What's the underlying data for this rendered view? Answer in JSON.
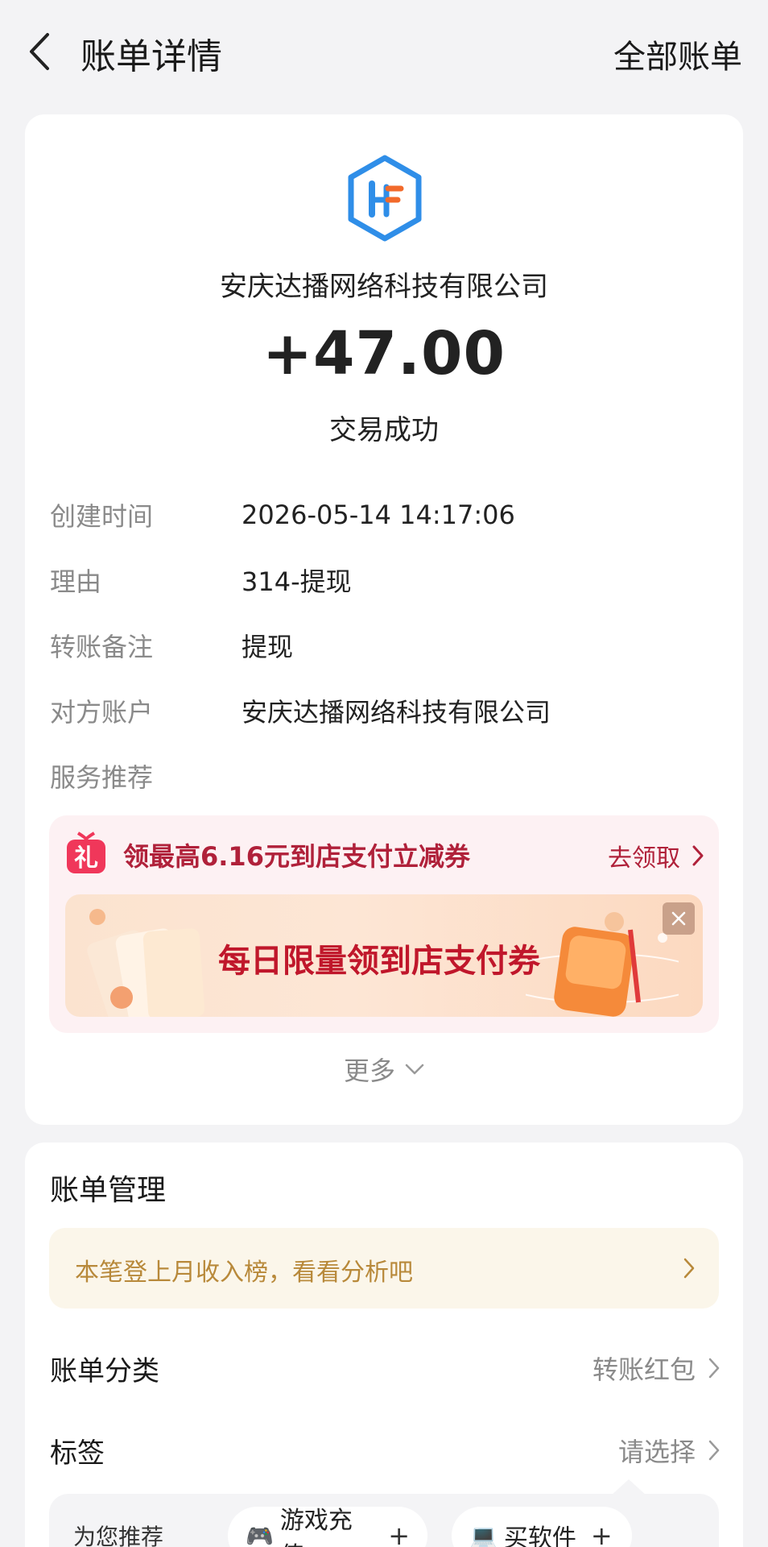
{
  "header": {
    "title": "账单详情",
    "all_bills": "全部账单"
  },
  "transaction": {
    "merchant": "安庆达播网络科技有限公司",
    "amount": "+47.00",
    "status": "交易成功"
  },
  "details": [
    {
      "label": "创建时间",
      "value": "2026-05-14 14:17:06"
    },
    {
      "label": "理由",
      "value": "314-提现"
    },
    {
      "label": "转账备注",
      "value": "提现"
    },
    {
      "label": "对方账户",
      "value": "安庆达播网络科技有限公司"
    },
    {
      "label": "服务推荐",
      "value": ""
    }
  ],
  "promo": {
    "title": "领最高6.16元到店支付立减券",
    "link": "去领取",
    "banner_text": "每日限量领到店支付券",
    "gift_glyph": "礼"
  },
  "more": "更多",
  "manage": {
    "title": "账单管理",
    "insight": "本笔登上月收入榜，看看分析吧",
    "category_label": "账单分类",
    "category_value": "转账红包",
    "tag_label": "标签",
    "tag_value": "请选择",
    "recommend_label": "为您推荐",
    "chips": [
      {
        "emoji": "🎮",
        "label": "游戏充值",
        "plus": "+"
      },
      {
        "emoji": "💻",
        "label": "买软件",
        "plus": "+"
      }
    ]
  },
  "colors": {
    "accent_red": "#b0213a",
    "logo_blue": "#2f8ee8",
    "logo_orange": "#f26a2b",
    "insight_gold": "#b8893a"
  }
}
